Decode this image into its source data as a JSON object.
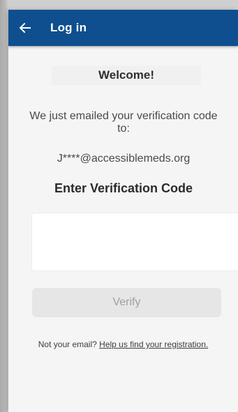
{
  "appbar": {
    "back_icon": "arrow-left-icon",
    "title": "Log in",
    "background_color": "#0f4f8f"
  },
  "main": {
    "welcome": "Welcome!",
    "intro": "We just emailed your verification code to:",
    "email": "J****@accessiblemeds.org",
    "enter_heading": "Enter Verification Code",
    "code_boxes": [
      "",
      "",
      "",
      ""
    ],
    "verify_label": "Verify",
    "help_prefix": "Not your email?",
    "help_link": "Help us find your registration."
  }
}
